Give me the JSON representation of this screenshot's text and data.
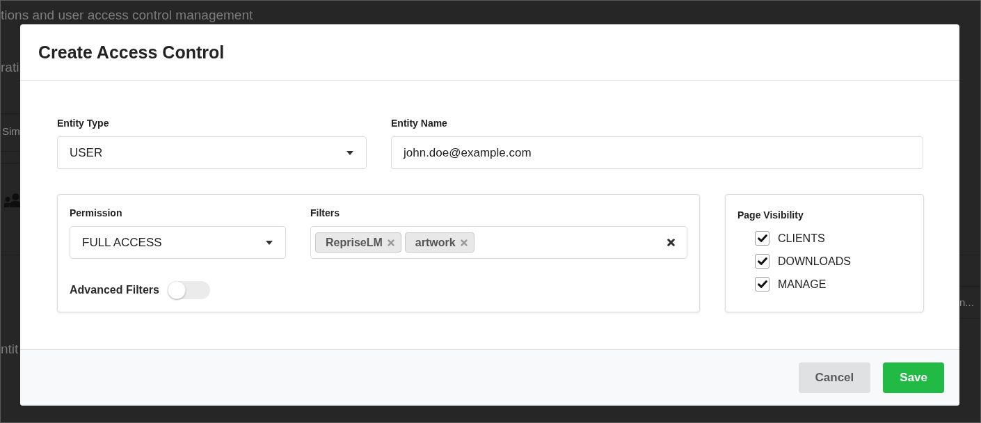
{
  "background_page": {
    "subtitle": "tions and user access control management",
    "left_edge": [
      {
        "kind": "text",
        "text": "rati"
      },
      {
        "kind": "muted",
        "text": "Sim"
      },
      {
        "kind": "icon"
      },
      {
        "kind": "text",
        "text": "ntit"
      }
    ],
    "right_edge": [
      {
        "kind": "muted",
        "text": "n..."
      }
    ]
  },
  "dialog": {
    "title": "Create Access Control",
    "entity_type": {
      "label": "Entity Type",
      "value": "USER"
    },
    "entity_name": {
      "label": "Entity Name",
      "value": "john.doe@example.com"
    },
    "permission": {
      "label": "Permission",
      "value": "FULL ACCESS"
    },
    "filters": {
      "label": "Filters",
      "tags": [
        "RepriseLM",
        "artwork"
      ]
    },
    "advanced_filters": {
      "label": "Advanced Filters",
      "on": false
    },
    "page_visibility": {
      "title": "Page Visibility",
      "items": [
        {
          "label": "CLIENTS",
          "checked": true
        },
        {
          "label": "DOWNLOADS",
          "checked": true
        },
        {
          "label": "MANAGE",
          "checked": true
        }
      ]
    },
    "buttons": [
      {
        "label": "Cancel",
        "kind": "secondary"
      },
      {
        "label": "Save",
        "kind": "primary"
      }
    ]
  }
}
